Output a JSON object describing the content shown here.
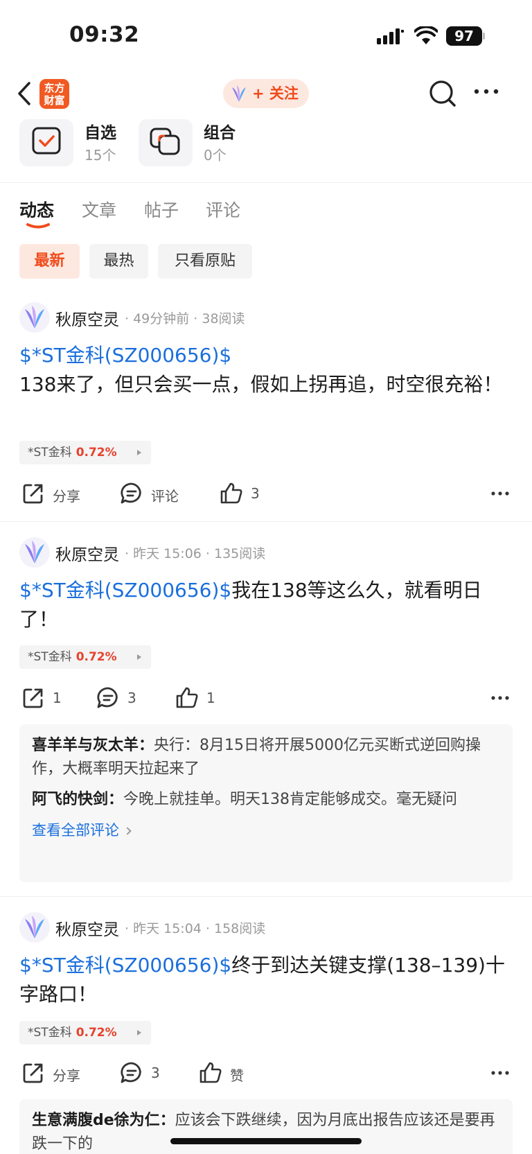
{
  "status_bar": {
    "time": "09:32",
    "battery": "97"
  },
  "nav": {
    "logo_line1": "东方",
    "logo_line2": "财富",
    "follow_label": "+ 关注"
  },
  "quick": [
    {
      "name": "自选",
      "count": "15个"
    },
    {
      "name": "组合",
      "count": "0个"
    }
  ],
  "tabs": [
    "动态",
    "文章",
    "帖子",
    "评论"
  ],
  "filters": [
    "最新",
    "最热",
    "只看原贴"
  ],
  "colors": {
    "accent": "#f04b1b",
    "link": "#1a6fdc",
    "up": "#e8412c"
  },
  "posts": [
    {
      "author": "秋原空灵",
      "meta": "· 49分钟前 · 38阅读",
      "stock_link": "$*ST金科(SZ000656)$",
      "text": "138来了，但只会买一点，假如上拐再追，时空很充裕！",
      "tag_name": "*ST金科",
      "tag_pct": "0.72%",
      "share": "分享",
      "comment": "评论",
      "like": "3"
    },
    {
      "author": "秋原空灵",
      "meta": "· 昨天 15:06 · 135阅读",
      "stock_link": "$*ST金科(SZ000656)$",
      "text": "我在138等这么久，就看明日了！",
      "tag_name": "*ST金科",
      "tag_pct": "0.72%",
      "share": "1",
      "comment": "3",
      "like": "1",
      "comments": [
        {
          "author": "喜羊羊与灰太羊：",
          "text": "央行：8月15日将开展5000亿元买断式逆回购操作，大概率明天拉起来了"
        },
        {
          "author": "阿飞的快剑：",
          "text": "今晚上就挂单。明天138肯定能够成交。毫无疑问"
        }
      ],
      "view_all": "查看全部评论"
    },
    {
      "author": "秋原空灵",
      "meta": "· 昨天 15:04 · 158阅读",
      "stock_link": "$*ST金科(SZ000656)$",
      "text": "终于到达关键支撑(138–139)十字路口！",
      "tag_name": "*ST金科",
      "tag_pct": "0.72%",
      "share": "分享",
      "comment": "3",
      "like": "赞",
      "comments": [
        {
          "author": "生意满腹de徐为仁：",
          "text": "应该会下跌继续，因为月底出报告应该还是要再跌一下的"
        }
      ]
    }
  ]
}
